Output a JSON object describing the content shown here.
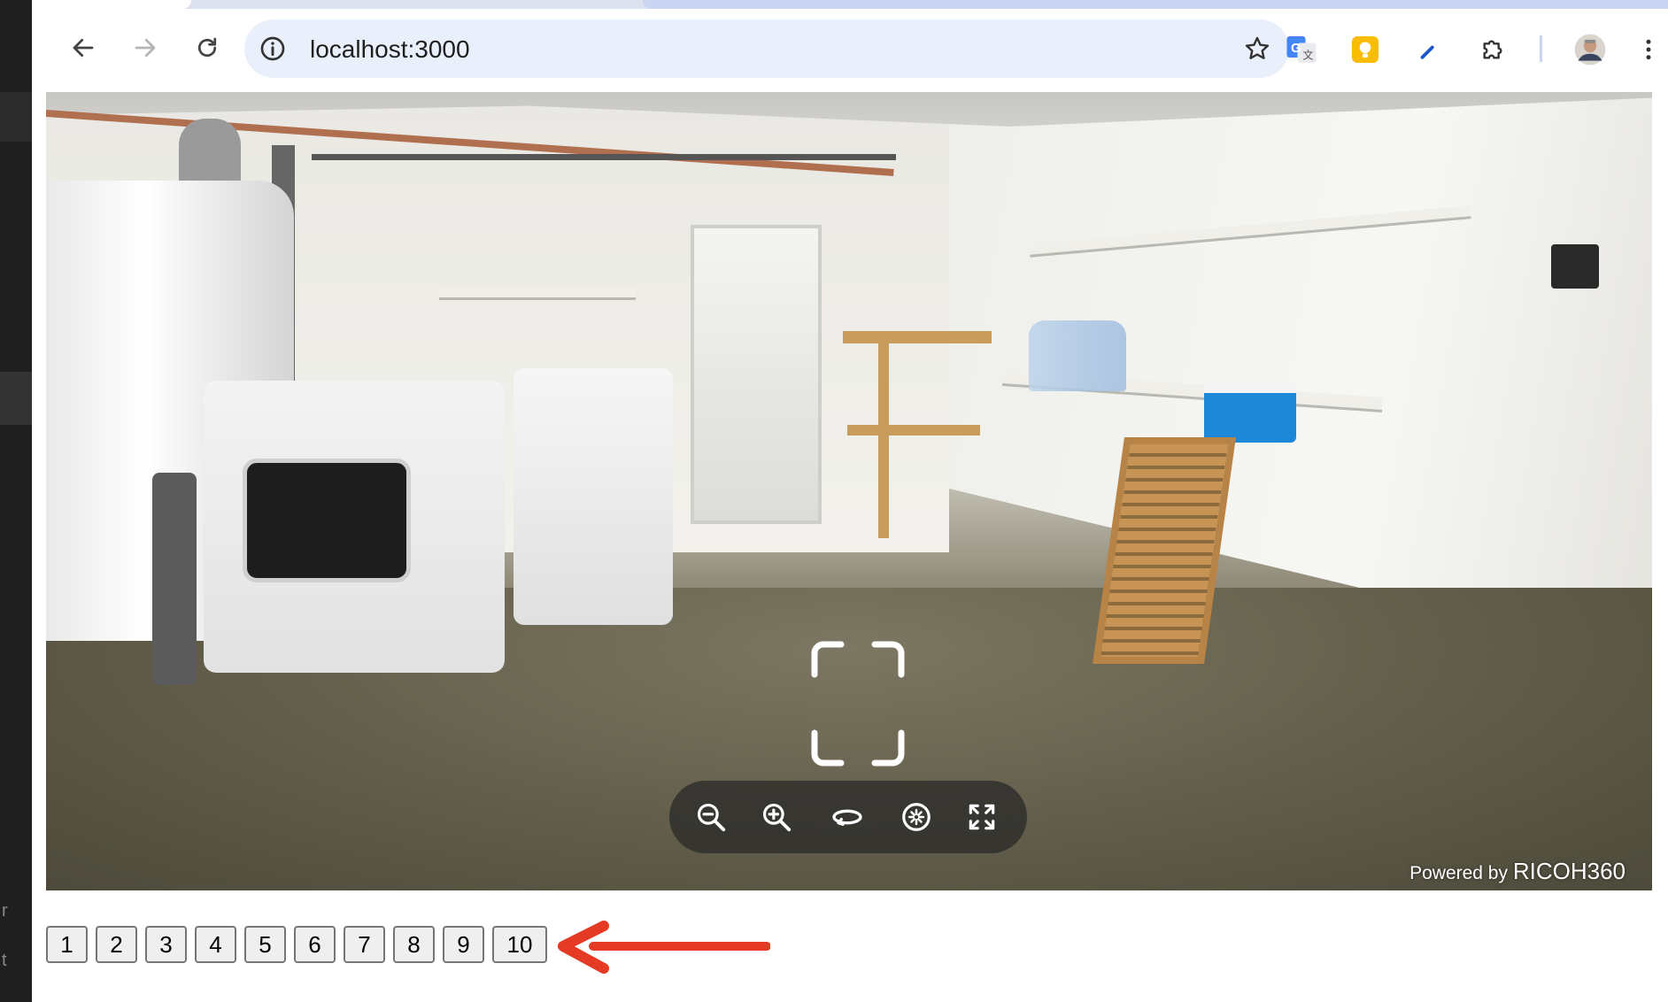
{
  "left_window": {
    "glyph_r": "r",
    "glyph_t": "t"
  },
  "browser": {
    "url": "localhost:3000",
    "icons": {
      "back": "arrow-left-icon",
      "forward": "arrow-right-icon",
      "reload": "reload-icon",
      "site_info": "info-circle-icon",
      "bookmark": "star-icon",
      "translate": "google-translate-icon",
      "keep": "lightbulb-icon",
      "pen": "pen-icon",
      "extensions": "puzzle-icon",
      "profile": "avatar",
      "menu": "three-dot-menu-icon"
    }
  },
  "viewer": {
    "scene": "360 panorama of a garage laundry room",
    "controls": [
      {
        "name": "zoom-out-icon",
        "title": "Zoom out"
      },
      {
        "name": "zoom-in-icon",
        "title": "Zoom in"
      },
      {
        "name": "rotate-icon",
        "title": "Auto rotate"
      },
      {
        "name": "gyro-icon",
        "title": "Gyro"
      },
      {
        "name": "fullscreen-icon",
        "title": "Fullscreen"
      }
    ],
    "powered_prefix": "Powered by",
    "powered_brand": "RICOH360"
  },
  "pager": {
    "pages": [
      "1",
      "2",
      "3",
      "4",
      "5",
      "6",
      "7",
      "8",
      "9",
      "10"
    ]
  },
  "colors": {
    "annotation_arrow": "#e53a24",
    "control_bar": "#282828",
    "cooler": "#1e88d8"
  }
}
